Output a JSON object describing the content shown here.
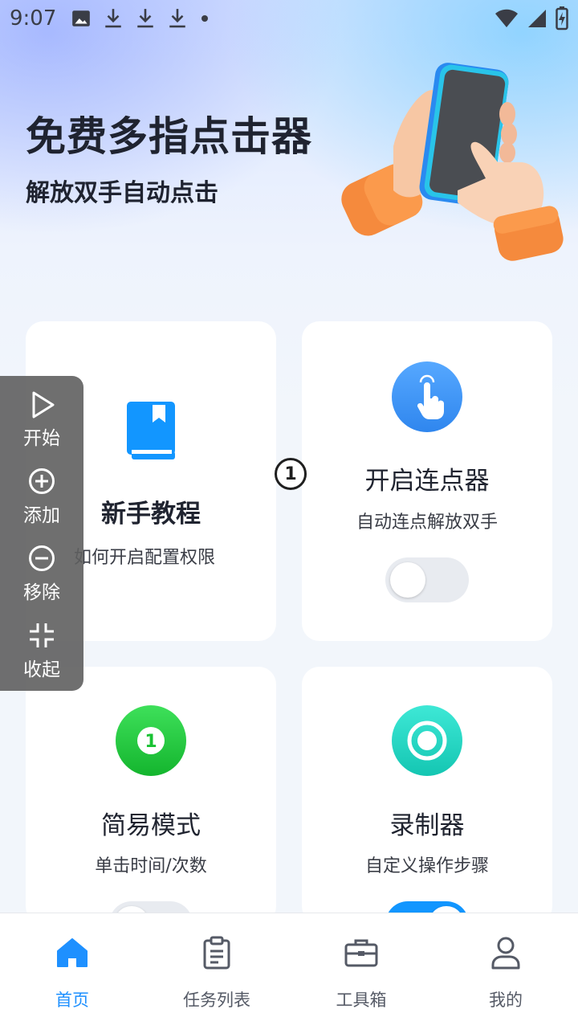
{
  "status_bar": {
    "time": "9:07",
    "left_icons": [
      "image-icon",
      "download-icon",
      "download-icon",
      "download-icon",
      "dot-icon"
    ],
    "right_icons": [
      "wifi-icon",
      "signal-icon",
      "battery-charging-icon"
    ]
  },
  "hero": {
    "title": "免费多指点击器",
    "subtitle": "解放双手自动点击"
  },
  "cards": {
    "tutorial": {
      "title": "新手教程",
      "desc": "如何开启配置权限",
      "icon": "book-icon",
      "icon_color": "#1296ff"
    },
    "clicker": {
      "title": "开启连点器",
      "desc": "自动连点解放双手",
      "icon": "tap-hand-icon",
      "icon_color": "#2f86ee",
      "enabled": false
    },
    "simple": {
      "title": "简易模式",
      "desc": "单击时间/次数",
      "icon": "number-one-icon",
      "icon_color": "#19c233",
      "enabled": false
    },
    "recorder": {
      "title": "录制器",
      "desc": "自定义操作步骤",
      "icon": "record-icon",
      "icon_color": "#20d3c0",
      "enabled": true
    }
  },
  "marker": {
    "label": "1"
  },
  "float_panel": {
    "items": [
      {
        "label": "开始",
        "icon": "play-icon"
      },
      {
        "label": "添加",
        "icon": "add-circle-icon"
      },
      {
        "label": "移除",
        "icon": "remove-circle-icon"
      },
      {
        "label": "收起",
        "icon": "collapse-icon"
      }
    ]
  },
  "bottom_nav": {
    "items": [
      {
        "label": "首页",
        "icon": "home-icon",
        "active": true
      },
      {
        "label": "任务列表",
        "icon": "clipboard-icon",
        "active": false
      },
      {
        "label": "工具箱",
        "icon": "toolbox-icon",
        "active": false
      },
      {
        "label": "我的",
        "icon": "user-icon",
        "active": false
      }
    ],
    "active_color": "#1e90ff"
  }
}
